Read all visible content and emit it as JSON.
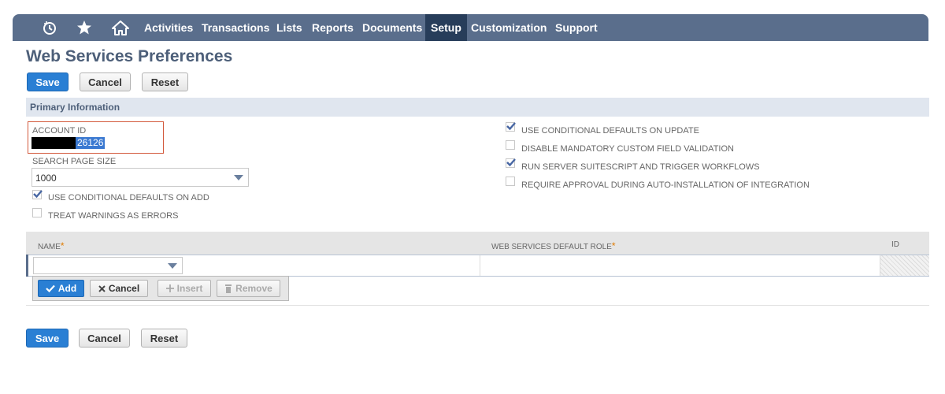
{
  "nav": {
    "icons": [
      "recent-icon",
      "star-icon",
      "home-icon"
    ],
    "items": [
      "Activities",
      "Transactions",
      "Lists",
      "Reports",
      "Documents",
      "Setup",
      "Customization",
      "Support"
    ],
    "active": "Setup"
  },
  "page": {
    "title": "Web Services Preferences"
  },
  "actions": {
    "save": "Save",
    "cancel": "Cancel",
    "reset": "Reset"
  },
  "primary": {
    "section_title": "Primary Information",
    "account_id_label": "ACCOUNT ID",
    "account_id_suffix": "26126",
    "search_page_size_label": "SEARCH PAGE SIZE",
    "search_page_size_value": "1000",
    "cb_defaults_on_add": {
      "label": "USE CONDITIONAL DEFAULTS ON ADD",
      "checked": true
    },
    "cb_warnings_errors": {
      "label": "TREAT WARNINGS AS ERRORS",
      "checked": false
    },
    "cb_defaults_on_update": {
      "label": "USE CONDITIONAL DEFAULTS ON UPDATE",
      "checked": true
    },
    "cb_disable_mandatory": {
      "label": "DISABLE MANDATORY CUSTOM FIELD VALIDATION",
      "checked": false
    },
    "cb_run_server": {
      "label": "RUN SERVER SUITESCRIPT AND TRIGGER WORKFLOWS",
      "checked": true
    },
    "cb_require_approval": {
      "label": "REQUIRE APPROVAL DURING AUTO-INSTALLATION OF INTEGRATION",
      "checked": false
    }
  },
  "grid": {
    "headers": {
      "name": "NAME",
      "role": "WEB SERVICES DEFAULT ROLE",
      "id": "ID"
    },
    "required_mark": "*",
    "buttons": {
      "add": "Add",
      "cancel": "Cancel",
      "insert": "Insert",
      "remove": "Remove"
    }
  },
  "colors": {
    "nav_bg": "#5a6e8c",
    "nav_active": "#273d5a",
    "primary_button": "#2a7fd4",
    "title": "#4d5f79",
    "highlight": "#d35a3d"
  }
}
